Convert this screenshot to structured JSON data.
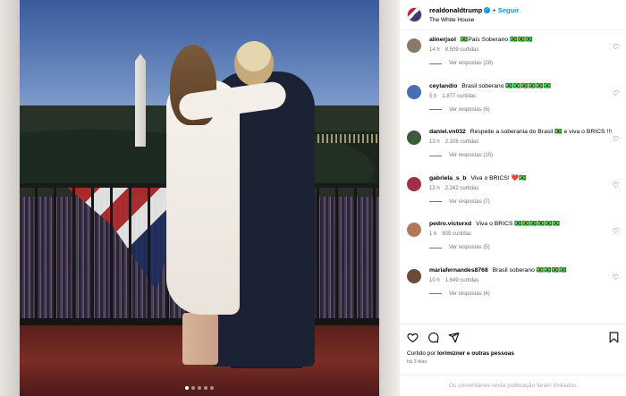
{
  "post": {
    "username": "realdonaldtrump",
    "verified_mark": "✓",
    "separator": "•",
    "follow_label": "Seguir",
    "location": "The White House",
    "more_icon": "more-horizontal-icon",
    "carousel_total_slides": 5,
    "carousel_active_slide": 1
  },
  "comments": [
    {
      "username": "alinerjsoI",
      "text": "🇧🇷País Soberano 🇧🇷🇧🇷🇧🇷",
      "time": "14 h",
      "likes": "8.509 curtidas",
      "replies": "Ver respostas (28)",
      "avatar_color": "#8a7a6a"
    },
    {
      "username": "ceylandio",
      "text": "Brasil soberano 🇧🇷🇧🇷🇧🇷🇧🇷🇧🇷🇧🇷",
      "time": "5 h",
      "likes": "1.877 curtidas",
      "replies": "Ver respostas (6)",
      "avatar_color": "#4a6fb0"
    },
    {
      "username": "daniel.vn032",
      "text": "Respeite a soberania do Brasil 🇧🇷 e viva o BRICS !!!",
      "time": "13 h",
      "likes": "2.108 curtidas",
      "replies": "Ver respostas (10)",
      "avatar_color": "#3d5a3a"
    },
    {
      "username": "gabriela_s_b",
      "text": "Viva o BRICS! ❤️🇧🇷",
      "time": "13 h",
      "likes": "2.242 curtidas",
      "replies": "Ver respostas (7)",
      "avatar_color": "#a0304a"
    },
    {
      "username": "pedro.victorxd",
      "text": "Viva o BRICS 🇧🇷🇧🇷🇧🇷🇧🇷🇧🇷🇧🇷",
      "time": "1 h",
      "likes": "805 curtidas",
      "replies": "Ver respostas (5)",
      "avatar_color": "#b07a5a"
    },
    {
      "username": "mariafernandes8768",
      "text": "Brasil soberano 🇧🇷🇧🇷🇧🇷🇧🇷",
      "time": "10 h",
      "likes": "1.649 curtidas",
      "replies": "Ver respostas (4)",
      "avatar_color": "#6a4a3a"
    }
  ],
  "actions": {
    "like_icon": "heart-outline-icon",
    "comment_icon": "comment-icon",
    "share_icon": "send-icon",
    "save_icon": "bookmark-icon",
    "liked_by_prefix": "Curtido por",
    "liked_by_user": "lorimizner",
    "liked_by_suffix": "e outras pessoas",
    "time_ago": "há 3 dias",
    "comments_limited": "Os comentários nesta publicação foram limitados."
  },
  "colors": {
    "accent_blue": "#0095f6",
    "secondary_text": "#737373",
    "border": "#efefef"
  }
}
